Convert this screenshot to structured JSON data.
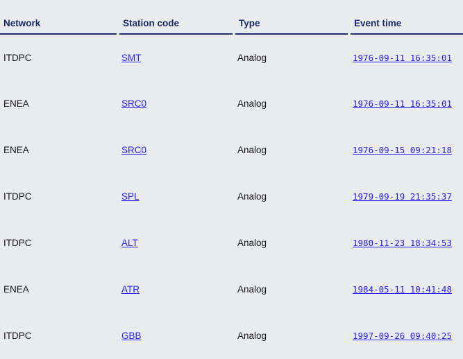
{
  "table": {
    "columns": [
      {
        "key": "network",
        "label": "Network"
      },
      {
        "key": "station_code",
        "label": "Station code"
      },
      {
        "key": "type",
        "label": "Type"
      },
      {
        "key": "event_time",
        "label": "Event time"
      }
    ],
    "rows": [
      {
        "network": "ITDPC",
        "station_code": "SMT",
        "type": "Analog",
        "event_time": "1976-09-11 16:35:01"
      },
      {
        "network": "ENEA",
        "station_code": "SRC0",
        "type": "Analog",
        "event_time": "1976-09-11 16:35:01"
      },
      {
        "network": "ENEA",
        "station_code": "SRC0",
        "type": "Analog",
        "event_time": "1976-09-15 09:21:18"
      },
      {
        "network": "ITDPC",
        "station_code": "SPL",
        "type": "Analog",
        "event_time": "1979-09-19 21:35:37"
      },
      {
        "network": "ITDPC",
        "station_code": "ALT",
        "type": "Analog",
        "event_time": "1980-11-23 18:34:53"
      },
      {
        "network": "ENEA",
        "station_code": "ATR",
        "type": "Analog",
        "event_time": "1984-05-11 10:41:48"
      },
      {
        "network": "ITDPC",
        "station_code": "GBB",
        "type": "Analog",
        "event_time": "1997-09-26 09:40:25"
      }
    ]
  },
  "colors": {
    "background": "#eaebed",
    "header_text": "#1b2a66",
    "header_rule": "#1f2f6b",
    "body_text": "#16161d",
    "link": "#2a20ee"
  }
}
